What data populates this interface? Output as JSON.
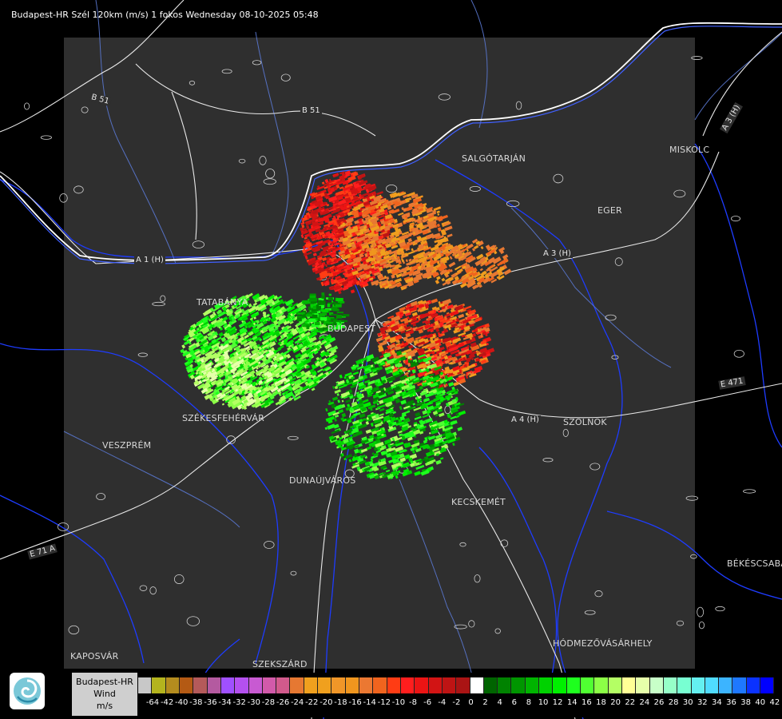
{
  "header": {
    "title": "Budapest-HR Szél 120km (m/s) 1 fokos Wednesday 08-10-2025 05:48"
  },
  "cities": [
    {
      "id": "salgotarjan",
      "label": "SALGÓTARJÁN"
    },
    {
      "id": "eger",
      "label": "EGER"
    },
    {
      "id": "miskolc",
      "label": "MISKOLC"
    },
    {
      "id": "budapest",
      "label": "BUDAPEST"
    },
    {
      "id": "tatabanya",
      "label": "TATABÁNYA"
    },
    {
      "id": "szekesfehervar",
      "label": "SZÉKESFEHÉRVÁR"
    },
    {
      "id": "veszprem",
      "label": "VESZPRÉM"
    },
    {
      "id": "dunaujvaros",
      "label": "DUNAÚJVÁROS"
    },
    {
      "id": "kecskemet",
      "label": "KECSKEMÉT"
    },
    {
      "id": "szolnok",
      "label": "SZOLNOK"
    },
    {
      "id": "bekescsaba",
      "label": "BÉKÉSCSABA"
    },
    {
      "id": "hodmezovasarhely",
      "label": "HÓDMEZŐVÁSÁRHELY"
    },
    {
      "id": "kaposvar",
      "label": "KAPOSVÁR"
    },
    {
      "id": "szekszard",
      "label": "SZEKSZÁRD"
    }
  ],
  "roads": [
    {
      "id": "b51-north",
      "label": "B 51"
    },
    {
      "id": "b51-mid",
      "label": "B 51"
    },
    {
      "id": "a1",
      "label": "A 1 (H)"
    },
    {
      "id": "a3-east",
      "label": "A 3 (H)"
    },
    {
      "id": "a3-ne",
      "label": "A 3 (H)"
    },
    {
      "id": "a4",
      "label": "A 4 (H)"
    },
    {
      "id": "e71",
      "label": "E 71 A"
    },
    {
      "id": "e471",
      "label": "E 471"
    }
  ],
  "legend": {
    "title_lines": [
      "Budapest-HR",
      "Wind",
      "m/s"
    ],
    "colors": [
      "#c8c8c8",
      "#b4b41e",
      "#b48c1e",
      "#b45a14",
      "#b45a5a",
      "#b45aa0",
      "#a050ff",
      "#b450f0",
      "#c85ad2",
      "#d25aaa",
      "#d25a8c",
      "#e67832",
      "#f0a01e",
      "#f0a01e",
      "#f09628",
      "#f0961e",
      "#eb7832",
      "#f0641e",
      "#ff3c14",
      "#ff1e1e",
      "#eb1414",
      "#d21414",
      "#be1414",
      "#aa1414",
      "#ffffff",
      "#006400",
      "#008200",
      "#009600",
      "#00b400",
      "#00d200",
      "#00f000",
      "#1eff1e",
      "#50ff32",
      "#8cff46",
      "#b4ff64",
      "#ffff96",
      "#e6ffaa",
      "#c8ffc8",
      "#96ffc8",
      "#78ffd2",
      "#64f0f0",
      "#50dcff",
      "#3cb4ff",
      "#1e78ff",
      "#0a32ff",
      "#0000ff"
    ],
    "ticks": [
      "-64",
      "-42",
      "-40",
      "-38",
      "-36",
      "-34",
      "-32",
      "-30",
      "-28",
      "-26",
      "-24",
      "-22",
      "-20",
      "-18",
      "-16",
      "-14",
      "-12",
      "-10",
      "-8",
      "-6",
      "-4",
      "-2",
      "0",
      "2",
      "4",
      "6",
      "8",
      "10",
      "12",
      "14",
      "16",
      "18",
      "20",
      "22",
      "24",
      "26",
      "28",
      "30",
      "32",
      "34",
      "36",
      "38",
      "40",
      "42"
    ]
  }
}
